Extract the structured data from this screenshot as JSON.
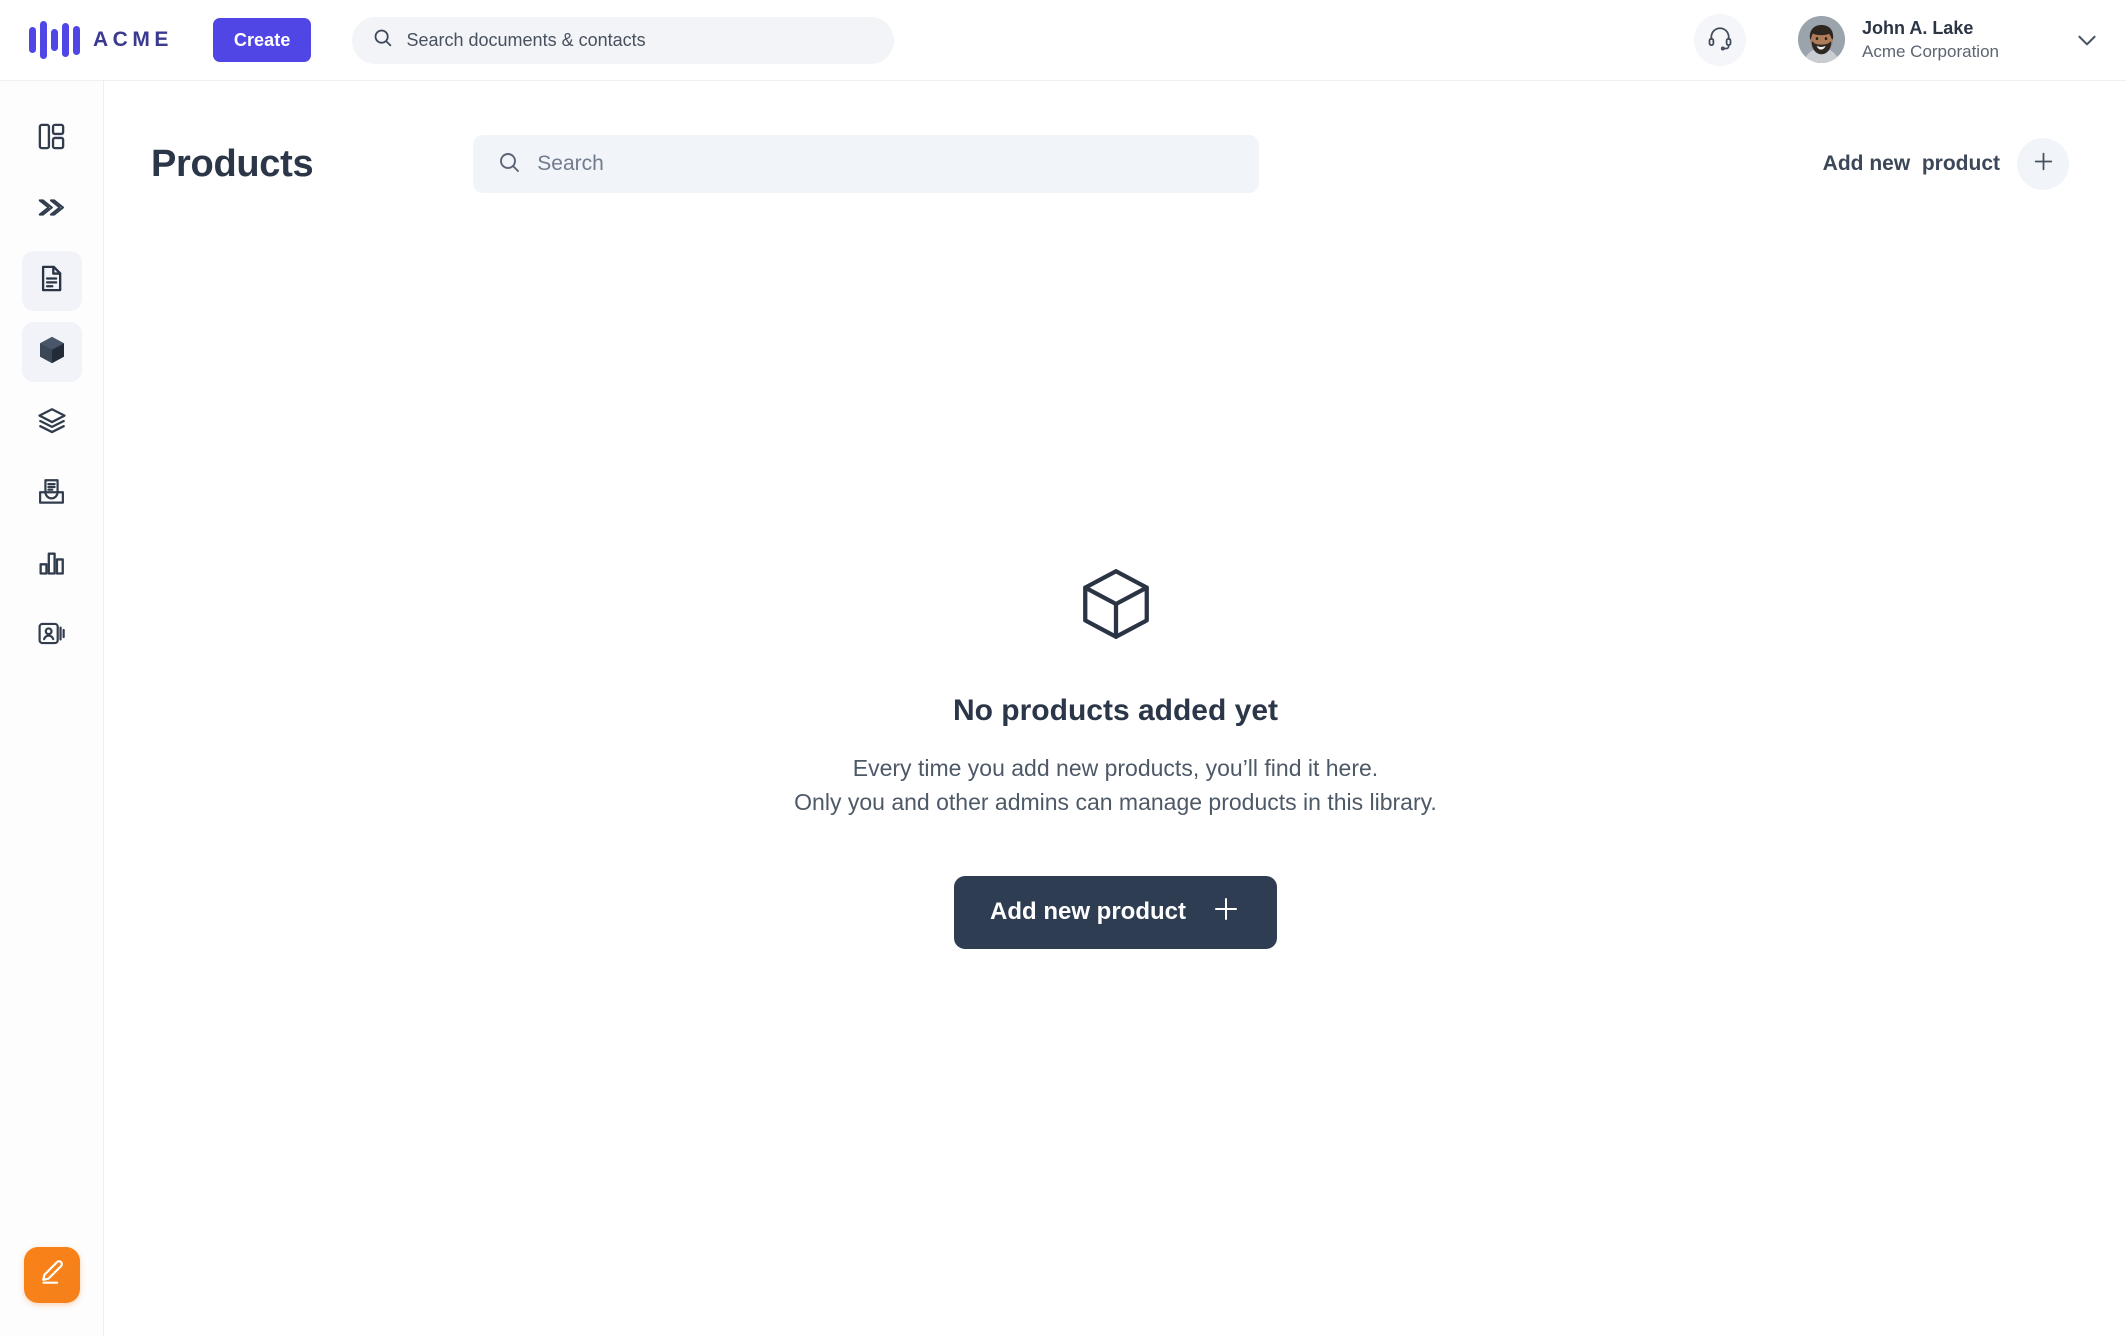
{
  "app": {
    "brand_name": "ACME",
    "accent_color": "#4f46e5",
    "dark_color": "#2f3d53",
    "compose_color": "#f5811b"
  },
  "topbar": {
    "create_label": "Create",
    "search": {
      "placeholder": "Search documents & contacts",
      "value": "",
      "icon": "search-icon"
    },
    "support_icon": "headset-icon",
    "user": {
      "name": "John A. Lake",
      "organization": "Acme Corporation",
      "avatar_icon": "user-avatar-photo",
      "chevron_icon": "chevron-down-icon"
    }
  },
  "sidebar": {
    "items": [
      {
        "name": "dashboard",
        "icon": "layout-dashboard-icon",
        "active": false
      },
      {
        "name": "pipelines",
        "icon": "chevrons-right-icon",
        "active": false
      },
      {
        "name": "documents",
        "icon": "document-icon",
        "active": true
      },
      {
        "name": "products",
        "icon": "cube-filled-icon",
        "active": true
      },
      {
        "name": "templates",
        "icon": "layers-icon",
        "active": false
      },
      {
        "name": "inbox",
        "icon": "inbox-document-icon",
        "active": false
      },
      {
        "name": "reports",
        "icon": "bar-chart-icon",
        "active": false
      },
      {
        "name": "contacts",
        "icon": "contact-card-icon",
        "active": false
      }
    ],
    "compose": {
      "icon": "pencil-edit-icon"
    }
  },
  "page": {
    "title": "Products",
    "search": {
      "placeholder": "Search",
      "value": "",
      "icon": "search-icon"
    },
    "add_link_label": "Add new  product",
    "add_round_icon": "plus-icon"
  },
  "empty_state": {
    "icon": "cube-outline-icon",
    "title": "No products added yet",
    "line1": "Every time you add new products, you’ll find it here.",
    "line2": "Only you and other admins can manage products in this library.",
    "cta_label": "Add new product",
    "cta_icon": "plus-icon"
  }
}
